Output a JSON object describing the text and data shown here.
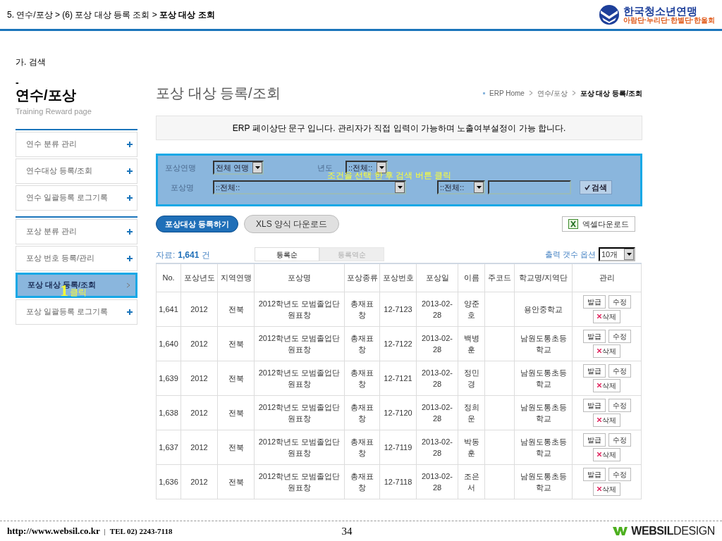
{
  "slide": {
    "breadcrumb": "5. 연수/포상 > (6) 포상 대상 등록 조회 > **포상 대상 조회**",
    "logo": {
      "name": "한국청소년연맹",
      "sub": "아람단·누리단·한별단·한울회"
    },
    "section": "가. 검색",
    "footer": {
      "url": "http://www.websil.co.kr",
      "sep": "|",
      "tel": "TEL 02) 2243-7118",
      "page": "34",
      "brand": "**WEBSIL**DESIGN"
    }
  },
  "sidebar": {
    "dash": "-",
    "title": "연수/포상",
    "subtitle": "Training Reward page",
    "groups": [
      [
        {
          "label": "연수 분류 관리",
          "selected": false
        },
        {
          "label": "연수대상 등록/조회",
          "selected": false
        },
        {
          "label": "연수 일괄등록 로그기록",
          "selected": false
        }
      ],
      [
        {
          "label": "포상 분류 관리",
          "selected": false
        },
        {
          "label": "포상 번호 등록/관리",
          "selected": false
        },
        {
          "label": "포상 대상 등록/조회",
          "selected": true
        },
        {
          "label": "포상 일괄등록 로그기록",
          "selected": false
        }
      ]
    ],
    "annotation": {
      "number": "1",
      "text": "클릭"
    }
  },
  "heading": "포상 대상 등록/조회",
  "breadcrumb": [
    "ERP Home",
    "연수/포상",
    "포상 대상 등록/조회"
  ],
  "notice": "ERP 페이상단 문구 입니다. 관리자가 직접 입력이 가능하며 노출여부설정이 가능 합니다.",
  "search": {
    "union_label": "포상연맹",
    "union_value": "전체 연맹",
    "year_label": "년도",
    "year_value": "::전체::",
    "award_label": "포상명",
    "award_value": "::전체::",
    "field_value": "::전체::",
    "button": "검색",
    "annotation": "조건을 선택 한 후 검색 버튼 클릭"
  },
  "actions": {
    "register": "포상대상 등록하기",
    "xls": "XLS 양식 다운로드",
    "excel": "엑셀다운로드"
  },
  "summary": {
    "prefix": "자료:",
    "count": "1,641",
    "suffix": "건",
    "sort_tabs": [
      {
        "label": "등록순",
        "selected": true
      },
      {
        "label": "등록역순",
        "selected": false
      }
    ],
    "page_size_label": "출력 갯수 옵션",
    "page_size": "10개"
  },
  "table": {
    "columns": [
      "No.",
      "포상년도",
      "지역연맹",
      "포상명",
      "포상종류",
      "포상번호",
      "포상일",
      "이름",
      "주코드",
      "학교명/지역단",
      "관리"
    ],
    "rows": [
      {
        "no": "1,641",
        "year": "2012",
        "region": "전북",
        "award": "2012학년도 모범졸업단원표창",
        "type": "총재표창",
        "number": "12-7123",
        "date": "2013-02-28",
        "name": "양준호",
        "school": "용안중학교",
        "buttons": [
          "발급",
          "수정",
          "삭제"
        ]
      },
      {
        "no": "1,640",
        "year": "2012",
        "region": "전북",
        "award": "2012학년도 모범졸업단원표창",
        "type": "총재표창",
        "number": "12-7122",
        "date": "2013-02-28",
        "name": "백병훈",
        "school": "남원도통초등학교",
        "buttons": [
          "발급",
          "수정",
          "삭제"
        ]
      },
      {
        "no": "1,639",
        "year": "2012",
        "region": "전북",
        "award": "2012학년도 모범졸업단원표창",
        "type": "총재표창",
        "number": "12-7121",
        "date": "2013-02-28",
        "name": "정민경",
        "school": "남원도통초등학교",
        "buttons": [
          "발급",
          "수정",
          "삭제"
        ]
      },
      {
        "no": "1,638",
        "year": "2012",
        "region": "전북",
        "award": "2012학년도 모범졸업단원표창",
        "type": "총재표창",
        "number": "12-7120",
        "date": "2013-02-28",
        "name": "정희운",
        "school": "남원도통초등학교",
        "buttons": [
          "발급",
          "수정",
          "삭제"
        ]
      },
      {
        "no": "1,637",
        "year": "2012",
        "region": "전북",
        "award": "2012학년도 모범졸업단원표창",
        "type": "총재표창",
        "number": "12-7119",
        "date": "2013-02-28",
        "name": "박동훈",
        "school": "남원도통초등학교",
        "buttons": [
          "발급",
          "수정",
          "삭제"
        ]
      },
      {
        "no": "1,636",
        "year": "2012",
        "region": "전북",
        "award": "2012학년도 모범졸업단원표창",
        "type": "총재표창",
        "number": "12-7118",
        "date": "2013-02-28",
        "name": "조은서",
        "school": "남원도통초등학교",
        "buttons": [
          "발급",
          "수정",
          "삭제"
        ]
      }
    ]
  }
}
